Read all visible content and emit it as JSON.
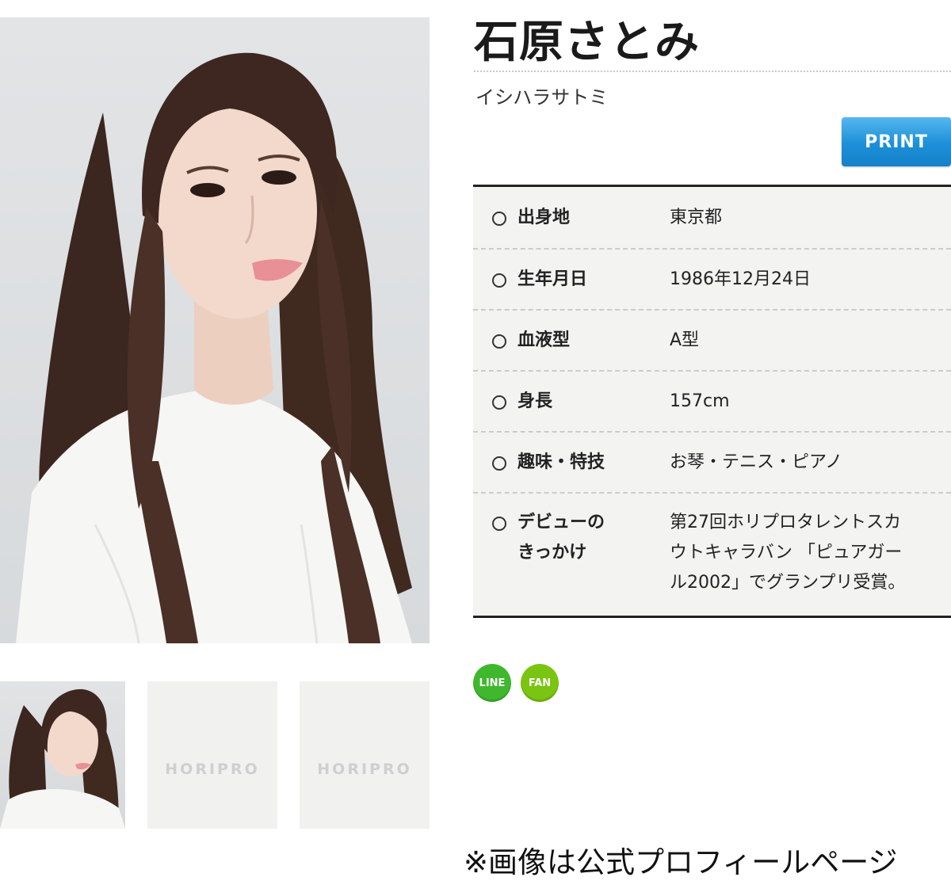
{
  "profile": {
    "name": "石原さとみ",
    "kana": "イシハラサトミ",
    "print_label": "PRINT",
    "rows": [
      {
        "label": "出身地",
        "value": "東京都"
      },
      {
        "label": "生年月日",
        "value": "1986年12月24日"
      },
      {
        "label": "血液型",
        "value": "A型"
      },
      {
        "label": "身長",
        "value": "157cm"
      },
      {
        "label": "趣味・特技",
        "value": "お琴・テニス・ピアノ"
      },
      {
        "label": "デビューのきっかけ",
        "label_lines": [
          "デビューの",
          "きっかけ"
        ],
        "value_lines": [
          "第27回ホリプロタレントスカ",
          "ウトキャラバン 「ピュアガー",
          "ル2002」でグランプリ受賞。"
        ]
      }
    ]
  },
  "gallery": {
    "logo_text": "HORIPRO"
  },
  "share": {
    "line_label": "LINE",
    "fan_label": "FAN",
    "line_color": "#3fb82e",
    "fan_color": "#7ac412"
  },
  "caption": "※画像は公式プロフィールページ",
  "colors": {
    "print_button": "#1c8fd8",
    "table_bg": "#f3f3f1"
  }
}
